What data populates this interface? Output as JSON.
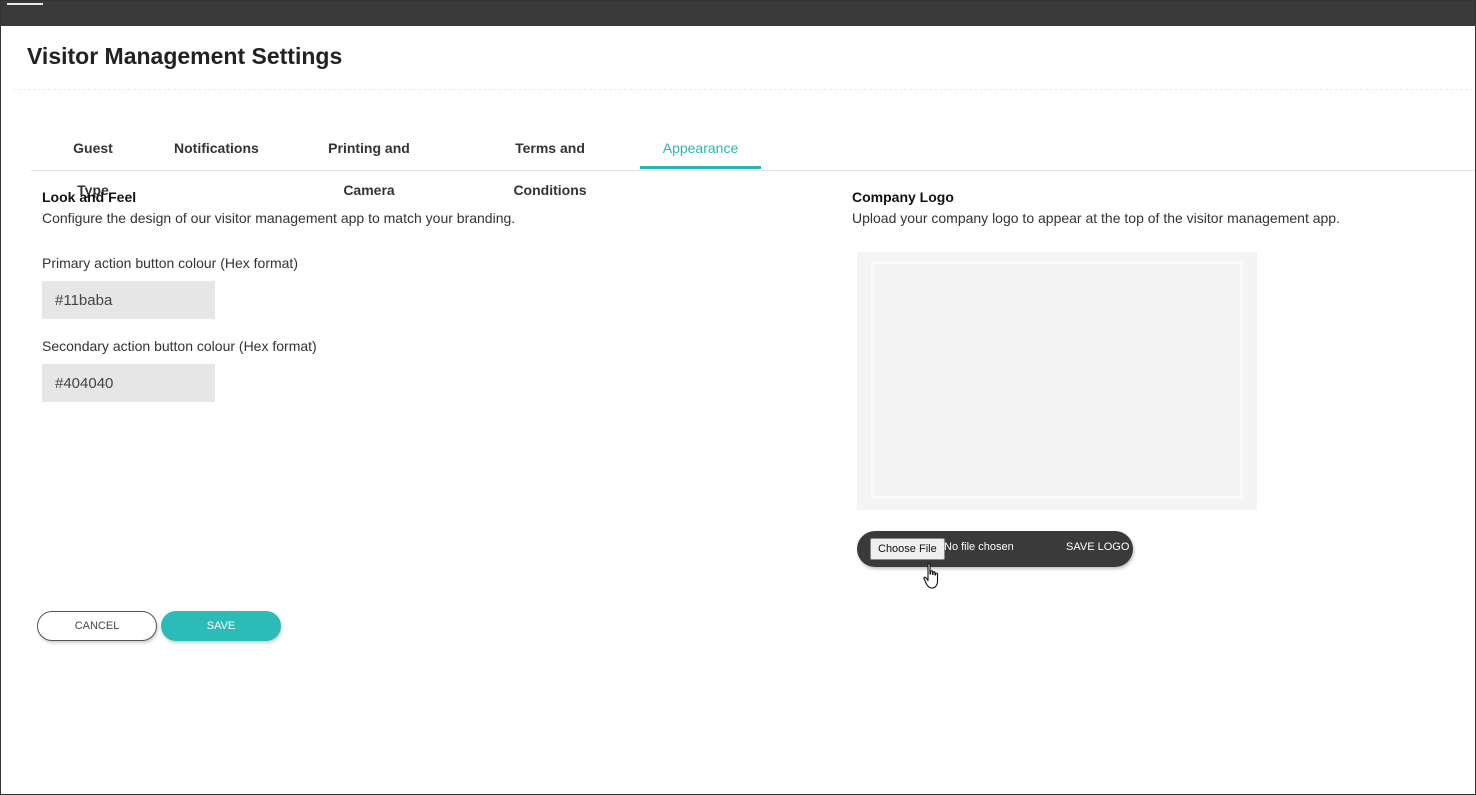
{
  "page": {
    "title": "Visitor Management Settings"
  },
  "tabs": [
    {
      "label": "Guest Type"
    },
    {
      "label": "Notifications"
    },
    {
      "label": "Printing and Camera"
    },
    {
      "label": "Terms and Conditions"
    },
    {
      "label": "Appearance",
      "active": true
    }
  ],
  "look_and_feel": {
    "heading": "Look and Feel",
    "description": "Configure the design of our visitor management app to match your branding.",
    "primary_label": "Primary action button colour (Hex format)",
    "primary_value": "#11baba",
    "secondary_label": "Secondary action button colour (Hex format)",
    "secondary_value": "#404040"
  },
  "company_logo": {
    "heading": "Company Logo",
    "description": "Upload your company logo to appear at the top of the visitor management app.",
    "choose_file_label": "Choose File",
    "no_file_text": "No file chosen",
    "save_logo_label": "SAVE LOGO"
  },
  "actions": {
    "cancel_label": "CANCEL",
    "save_label": "SAVE"
  },
  "colors": {
    "accent": "#2bbcb8",
    "topbar": "#3a3a3a"
  }
}
